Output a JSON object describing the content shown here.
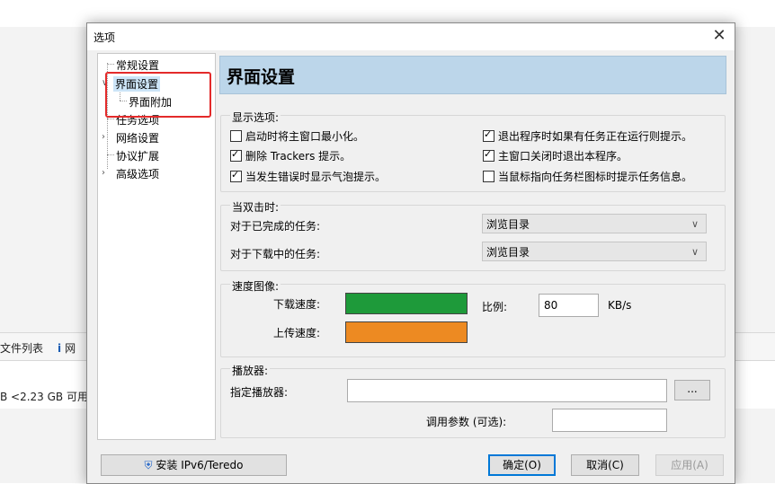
{
  "background": {
    "tab_files": "文件列表",
    "tab_net": "网",
    "status": "B <2.23 GB 可用"
  },
  "dialog": {
    "title": "选项",
    "close": "✕",
    "tree": {
      "general": "常规设置",
      "interface": "界面设置",
      "interface_extra": "界面附加",
      "tasks": "任务选项",
      "network": "网络设置",
      "protocols": "协议扩展",
      "advanced": "高级选项"
    },
    "header": "界面设置",
    "display": {
      "label": "显示选项:",
      "minimize": "启动时将主窗口最小化。",
      "delete_trackers": "删除 Trackers 提示。",
      "error_bubble": "当发生错误时显示气泡提示。",
      "exit_prompt": "退出程序时如果有任务正在运行则提示。",
      "close_exit": "主窗口关闭时退出本程序。",
      "tray_hover": "当鼠标指向任务栏图标时提示任务信息。"
    },
    "doubleclick": {
      "label": "当双击时:",
      "completed_label": "对于已完成的任务:",
      "completed_value": "浏览目录",
      "downloading_label": "对于下载中的任务:",
      "downloading_value": "浏览目录"
    },
    "speed": {
      "label": "速度图像:",
      "download_label": "下载速度:",
      "upload_label": "上传速度:",
      "download_color": "#1e9a3a",
      "upload_color": "#ed8a22",
      "ratio_label": "比例:",
      "ratio_value": "80",
      "unit": "KB/s"
    },
    "player": {
      "label": "播放器:",
      "specify_label": "指定播放器:",
      "specify_value": "",
      "browse": "...",
      "params_label": "调用参数 (可选):",
      "params_value": ""
    },
    "footer": {
      "install": "安装 IPv6/Teredo",
      "ok": "确定(O)",
      "cancel": "取消(C)",
      "apply": "应用(A)"
    },
    "checks": {
      "minimize": false,
      "delete_trackers": true,
      "error_bubble": true,
      "exit_prompt": true,
      "close_exit": true,
      "tray_hover": false
    }
  }
}
